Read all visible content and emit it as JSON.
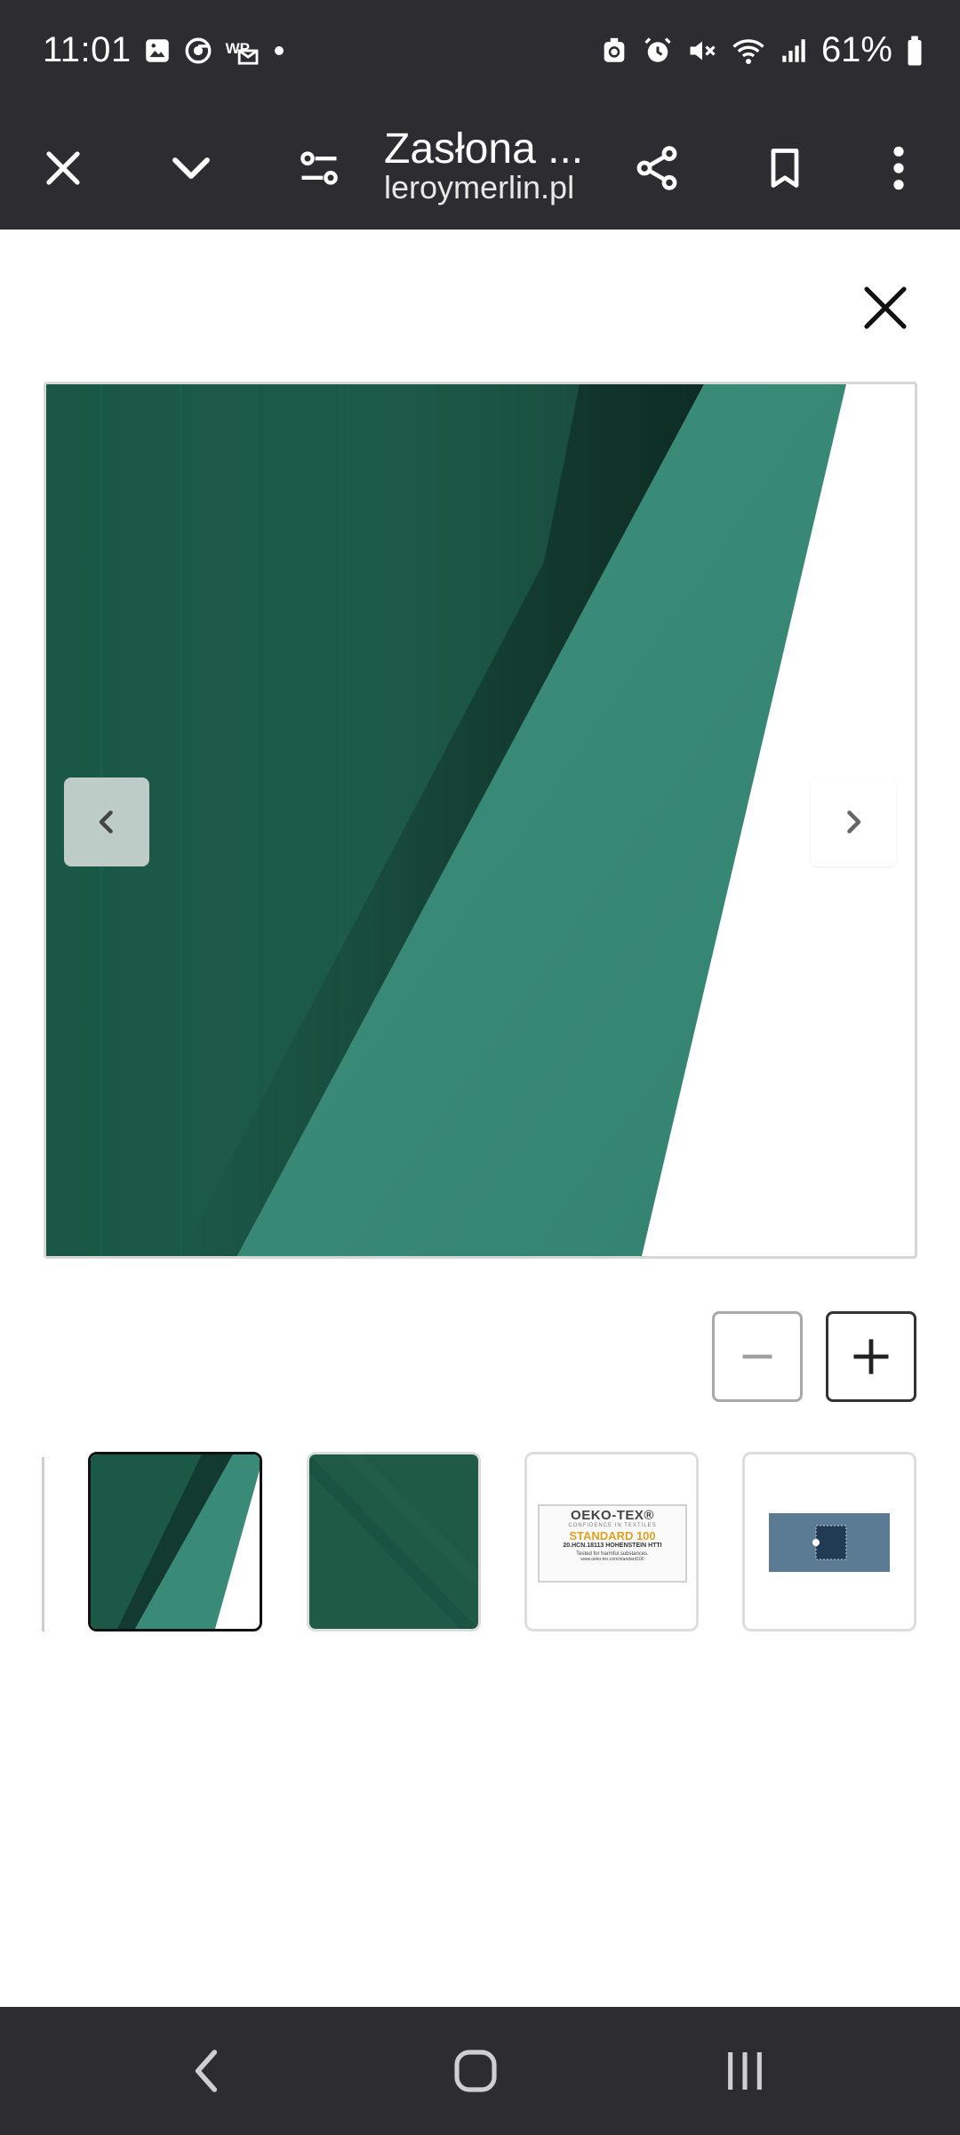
{
  "status_bar": {
    "time": "11:01",
    "battery_percent": "61%",
    "icons_left": [
      "gallery-icon",
      "chrome-icon",
      "wp-mail-icon",
      "dot-icon"
    ],
    "icons_right": [
      "recycle-icon",
      "alarm-icon",
      "mute-icon",
      "wifi-icon",
      "signal-icon",
      "battery-icon"
    ]
  },
  "browser": {
    "title": "Zasłona ...",
    "url": "leroymerlin.pl",
    "actions": [
      "close-icon",
      "chevron-down-icon",
      "page-settings-icon",
      "share-icon",
      "bookmark-icon",
      "more-vert-icon"
    ]
  },
  "gallery": {
    "zoom_out_label": "−",
    "zoom_in_label": "+",
    "thumbnails": [
      {
        "name": "thumb-partial",
        "selected": false
      },
      {
        "name": "thumb-curtain-fold",
        "selected": true
      },
      {
        "name": "thumb-fabric",
        "selected": false
      },
      {
        "name": "thumb-oeko-tex",
        "selected": false
      },
      {
        "name": "thumb-blue-swatch",
        "selected": false
      }
    ],
    "oeko_tex": {
      "brand": "OEKO-TEX®",
      "tagline": "CONFIDENCE IN TEXTILES",
      "standard": "STANDARD 100",
      "number": "20.HCN.18113 HOHENSTEIN HTTI",
      "tested": "Tested for harmful substances.",
      "site": "www.oeko-tex.com/standard100"
    }
  },
  "colors": {
    "system_bar": "#2d2d31",
    "curtain_dark": "#1d5a48",
    "curtain_light": "#3a8a78"
  }
}
